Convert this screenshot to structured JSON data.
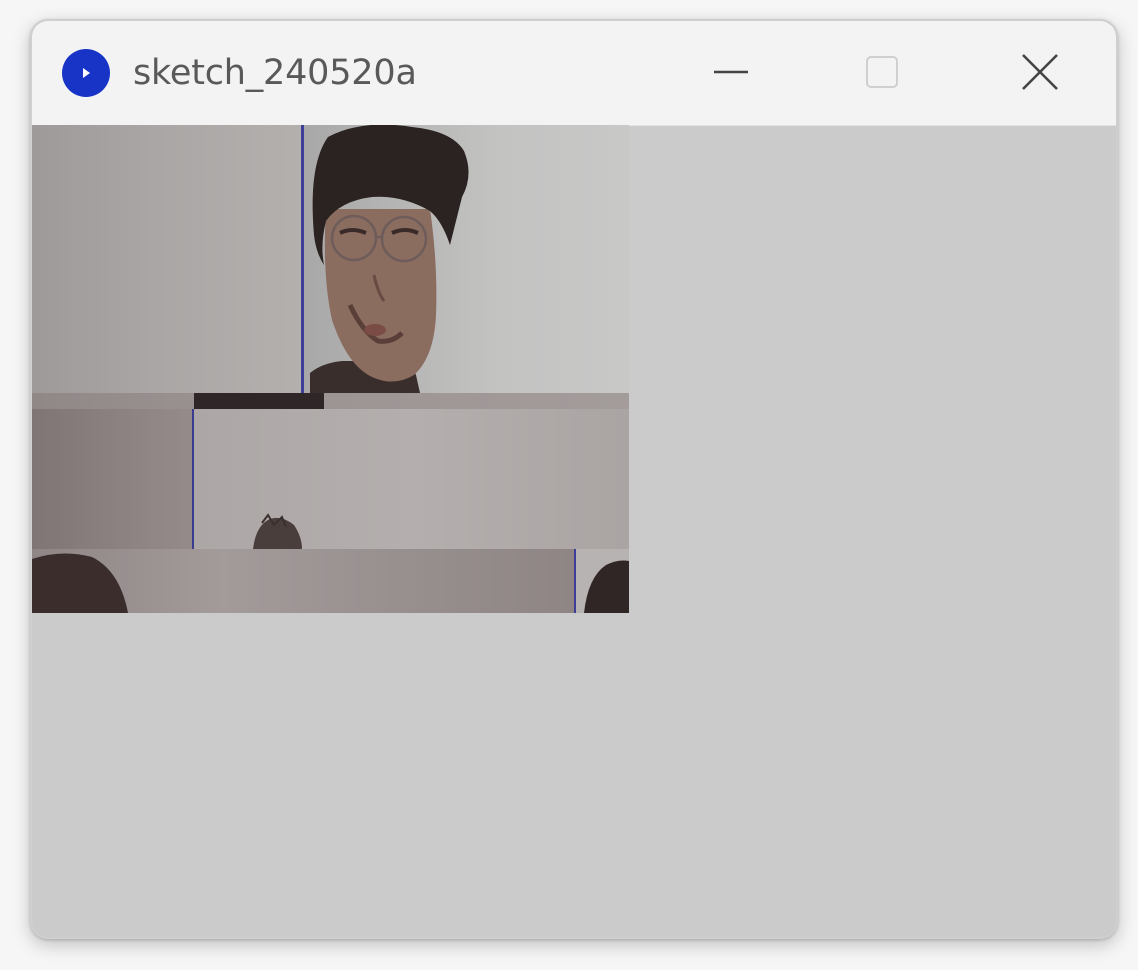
{
  "window": {
    "title": "sketch_240520a",
    "app_icon": "processing-play-icon",
    "controls": {
      "minimize_icon": "minimize-icon",
      "maximize_icon": "maximize-icon",
      "close_icon": "close-icon"
    }
  },
  "colors": {
    "titlebar": "#f3f3f3",
    "window_background": "#cbcbcb",
    "app_icon": "#1734c7",
    "title_text": "#595959"
  }
}
